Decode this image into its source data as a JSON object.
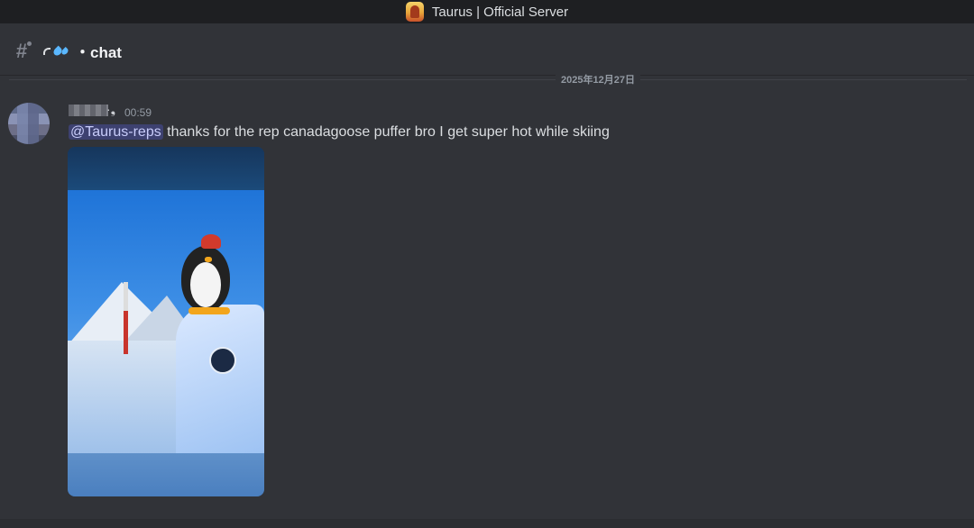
{
  "window": {
    "title": "Taurus | Official Server",
    "server_icon": "server-avatar-icon"
  },
  "channel": {
    "icon": "hash-icon",
    "emoji": "droplets-icon",
    "name": "・chat"
  },
  "date_divider": "2025年12月27日",
  "message": {
    "timestamp": "00:59",
    "mention": "@Taurus-reps",
    "text": "thanks for the rep canadagoose puffer bro I get super hot while skiing",
    "attachment": "image"
  },
  "colors": {
    "background": "#313338",
    "titlebar": "#1e1f22",
    "mention_bg": "#5865f24d",
    "mention_text": "#c9cdfb"
  }
}
